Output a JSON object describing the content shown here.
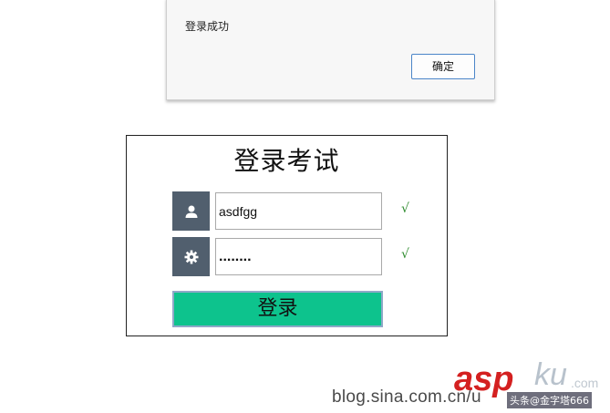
{
  "alert": {
    "message": "登录成功",
    "ok_label": "确定"
  },
  "login": {
    "title": "登录考试",
    "username_value": "asdfgg",
    "password_value": "........",
    "username_check": "√",
    "password_check": "√",
    "submit_label": "登录"
  },
  "watermark": {
    "url_text": "blog.sina.com.cn/u",
    "brand_asp": "asp",
    "brand_ku": "ku",
    "brand_com": ".com",
    "tag_text": "头条@金字塔666"
  },
  "colors": {
    "icon_bg": "#515f6e",
    "submit_bg": "#0dc38d",
    "check": "#2e8b2e",
    "brand_red": "#d42020"
  }
}
